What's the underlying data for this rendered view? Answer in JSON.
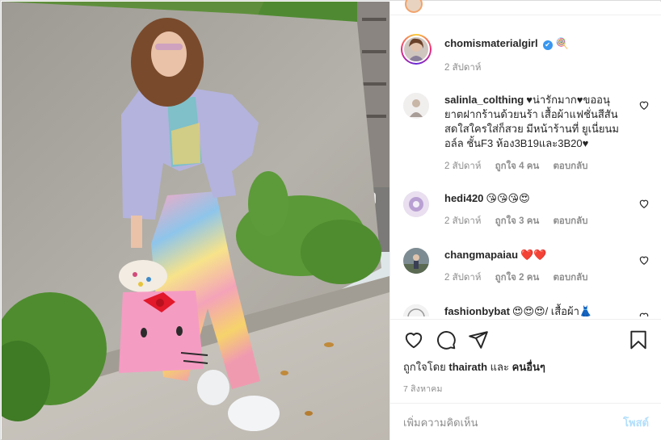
{
  "post": {
    "author": {
      "username": "chomismaterialgirl",
      "verified_badge": "✔",
      "emoji": "🍭",
      "time": "2 สัปดาห์"
    }
  },
  "comments": [
    {
      "username": "salinla_colthing",
      "text": "♥น่ารักมาก♥ขออนุยาตฝากร้านด้วยนร้า เสื้อผ้าแฟชั่นสีสันสดใสใครใส่ก็สวย มีหน้าร้านที่ ยูเนี่ยนมอล์ล ชั้นF3 ห้อง3B19และ3B20♥",
      "time": "2 สัปดาห์",
      "likes": "ถูกใจ 4 คน",
      "reply": "ตอบกลับ"
    },
    {
      "username": "hedi420",
      "text": "😘😘😘😍",
      "time": "2 สัปดาห์",
      "likes": "ถูกใจ 3 คน",
      "reply": "ตอบกลับ"
    },
    {
      "username": "changmapaiau",
      "text": "❤️❤️",
      "time": "2 สัปดาห์",
      "likes": "ถูกใจ 2 คน",
      "reply": "ตอบกลับ"
    },
    {
      "username": "fashionbybat",
      "text": "😍😍😍/ เสื้อผ้า👗"
    }
  ],
  "actions": {
    "like_icon": "heart-outline",
    "comment_icon": "speech-bubble",
    "share_icon": "paper-plane",
    "save_icon": "bookmark",
    "liked_by_prefix": "ถูกใจโดย",
    "liked_by_user": "thairath",
    "liked_by_and": "และ",
    "liked_by_others": "คนอื่นๆ",
    "date": "7 สิงหาคม"
  },
  "composer": {
    "placeholder": "เพิ่มความคิดเห็น",
    "post_label": "โพสต์"
  },
  "colors": {
    "post_button_disabled": "#b2dffc",
    "verified_badge": "#3897f0",
    "meta_text": "#8e8e8e"
  }
}
